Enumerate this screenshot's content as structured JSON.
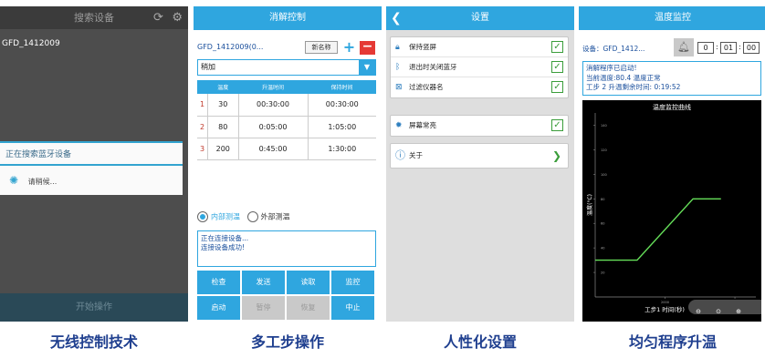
{
  "screen1": {
    "title": "搜索设备",
    "device": "GFD_1412009",
    "dialog_title": "正在搜索蓝牙设备",
    "dialog_message": "请稍候...",
    "bottom_button": "开始操作"
  },
  "screen2": {
    "title": "消解控制",
    "device": "GFD_1412009(0...",
    "new_name_button": "新名称",
    "add_button": "+",
    "remove_button": "−",
    "mode_select": "稍加",
    "table": {
      "headers": [
        "",
        "温度",
        "升温时间",
        "保持时间"
      ],
      "rows": [
        [
          "1",
          "30",
          "00:30:00",
          "00:30:00"
        ],
        [
          "2",
          "80",
          "0:05:00",
          "1:05:00"
        ],
        [
          "3",
          "200",
          "0:45:00",
          "1:30:00"
        ]
      ]
    },
    "radio_internal": "内部测温",
    "radio_external": "外部测温",
    "log_line1": "正在连接设备...",
    "log_line2": "连接设备成功!",
    "buttons": [
      "检查",
      "发送",
      "读取",
      "监控",
      "启动",
      "暂停",
      "恢复",
      "中止"
    ]
  },
  "screen3": {
    "title": "设置",
    "items": [
      "保持竖屏",
      "退出时关闭蓝牙",
      "过滤仪器名",
      "屏幕常亮",
      "关于"
    ]
  },
  "screen4": {
    "title": "温度监控",
    "device": "设备：GFD_1412...",
    "time": [
      "0",
      "01",
      "00"
    ],
    "status_line1": "消解程序已启动!",
    "status_line2": "当前温度:80.4 温度正常",
    "status_line3": "工步 2 升温剩余时间: 0:19:52",
    "chart_title": "温度监控曲线",
    "ylabel": "温度(°C)",
    "xlabel": "工步1 时间(秒)",
    "zoom": [
      "⊖",
      "⊙",
      "⊕"
    ]
  },
  "captions": [
    "无线控制技术",
    "多工步操作",
    "人性化设置",
    "均匀程序升温"
  ],
  "chart_data": {
    "type": "line",
    "title": "温度监控曲线",
    "xlabel": "工步1 时间(秒)",
    "ylabel": "温度(°C)",
    "x_ticks": [
      "2000",
      "4000"
    ],
    "y_ticks": [
      "20",
      "40",
      "60",
      "80",
      "100",
      "120",
      "140"
    ],
    "xlim": [
      0,
      4600
    ],
    "ylim": [
      0,
      150
    ],
    "series": [
      {
        "x": [
          0,
          1200,
          2800,
          3600
        ],
        "y": [
          30,
          30,
          80,
          80
        ]
      }
    ]
  }
}
